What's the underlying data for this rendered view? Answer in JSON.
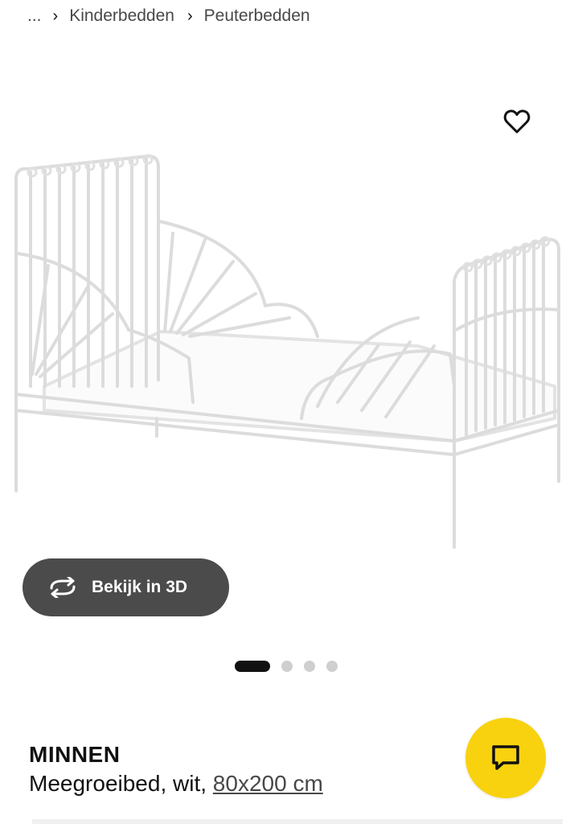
{
  "breadcrumb": {
    "ellipsis": "...",
    "separator": "›",
    "items": [
      {
        "label": "Kinderbedden"
      },
      {
        "label": "Peuterbedden"
      }
    ]
  },
  "favorite": {
    "icon": "heart-outline-icon"
  },
  "image": {
    "alt": "MINNEN Meegroeibed, wit"
  },
  "view3d": {
    "label": "Bekijk in 3D",
    "icon": "rotate-3d-icon"
  },
  "carousel": {
    "count": 4,
    "active_index": 0
  },
  "product": {
    "name": "MINNEN",
    "description_prefix": "Meegroeibed, wit, ",
    "size": "80x200 cm"
  },
  "chat": {
    "icon": "chat-bubble-icon",
    "color": "#f8d20f"
  }
}
